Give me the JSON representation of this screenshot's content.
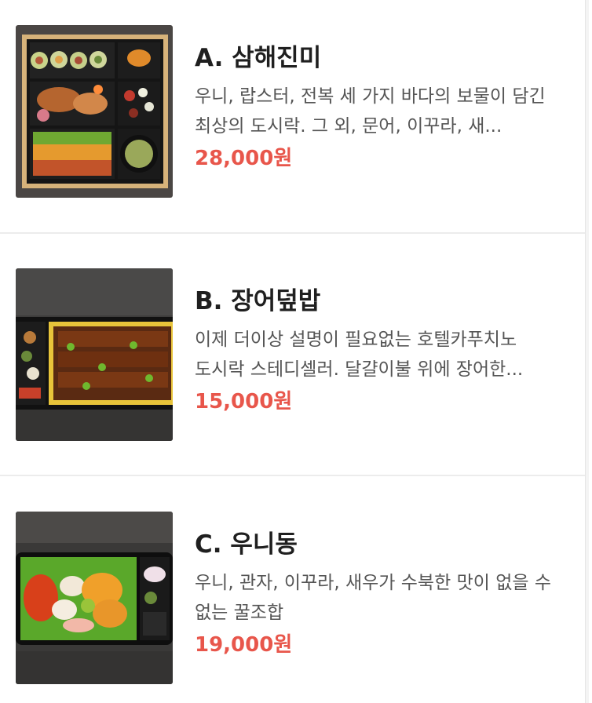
{
  "menu": {
    "items": [
      {
        "name": "A. 삼해진미",
        "description": "우니, 랍스터, 전복 세 가지 바다의 보물이 담긴 최상의 도시락. 그 외, 문어, 이꾸라, 새...",
        "price": "28,000원",
        "image_icon": "bento-box-image"
      },
      {
        "name": "B. 장어덮밥",
        "description": "이제 더이상 설명이 필요없는 호텔카푸치노 도시락 스테디셀러. 달걀이불 위에 장어한...",
        "price": "15,000원",
        "image_icon": "eel-rice-image"
      },
      {
        "name": "C. 우니동",
        "description": "우니, 관자, 이꾸라, 새우가 수북한 맛이 없을 수 없는 꿀조합",
        "price": "19,000원",
        "image_icon": "uni-don-image"
      }
    ]
  },
  "colors": {
    "price": "#e8564b",
    "title": "#1f1f1f",
    "description": "#555555",
    "divider": "#ececec"
  }
}
